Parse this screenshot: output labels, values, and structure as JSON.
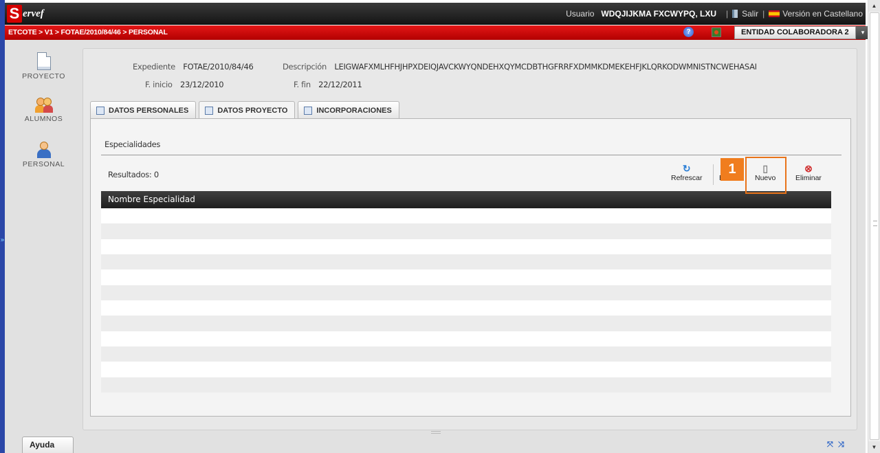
{
  "app": {
    "logo_letter": "S",
    "logo_rest": "ervef"
  },
  "topbar": {
    "user_label": "Usuario",
    "user_name": "WDQJIJKMA FXCWYPQ, LXU",
    "exit_label": "Salir",
    "language_label": "Versión en Castellano",
    "separator": "|"
  },
  "redbar": {
    "breadcrumb": "ETCOTE > V1 > FOTAE/2010/84/46 > PERSONAL",
    "help_glyph": "?",
    "entity_selected": "ENTIDAD COLABORADORA 2",
    "entity_arrow": "▾"
  },
  "sidebar": {
    "items": [
      {
        "label": "PROYECTO",
        "icon": "document-icon"
      },
      {
        "label": "ALUMNOS",
        "icon": "students-icon"
      },
      {
        "label": "PERSONAL",
        "icon": "person-icon"
      }
    ]
  },
  "project": {
    "expediente_label": "Expediente",
    "expediente_value": "FOTAE/2010/84/46",
    "descripcion_label": "Descripción",
    "descripcion_value": "LEIGWAFXMLHFHJHPXDEIQJAVCKWYQNDEHXQYMCDBTHGFRRFXDMMKDMEKEHFJKLQRKODWMNISTNCWEHASAI",
    "finicio_label": "F. inicio",
    "finicio_value": "23/12/2010",
    "ffin_label": "F. fin",
    "ffin_value": "22/12/2011"
  },
  "tabs": [
    {
      "label": "DATOS PERSONALES",
      "active": false
    },
    {
      "label": "DATOS PROYECTO",
      "active": true
    },
    {
      "label": "INCORPORACIONES",
      "active": false
    }
  ],
  "section": {
    "title": "Especialidades",
    "results_label": "Resultados: 0"
  },
  "toolbar": {
    "refresh_label": "Refrescar",
    "edit_label": "E",
    "new_label": "Nuevo",
    "delete_label": "Eliminar"
  },
  "callout": {
    "number": "1",
    "color": "#f07d1e"
  },
  "grid": {
    "columns": [
      "Nombre Especialidad"
    ],
    "rows": []
  },
  "footer": {
    "help_label": "Ayuda",
    "collapse_glyph": "⤧ ⤨"
  },
  "colors": {
    "topbar": "#1e1e1e",
    "redbar": "#d00000",
    "accent_blue": "#2b47a8",
    "callout_orange": "#e8731a"
  }
}
